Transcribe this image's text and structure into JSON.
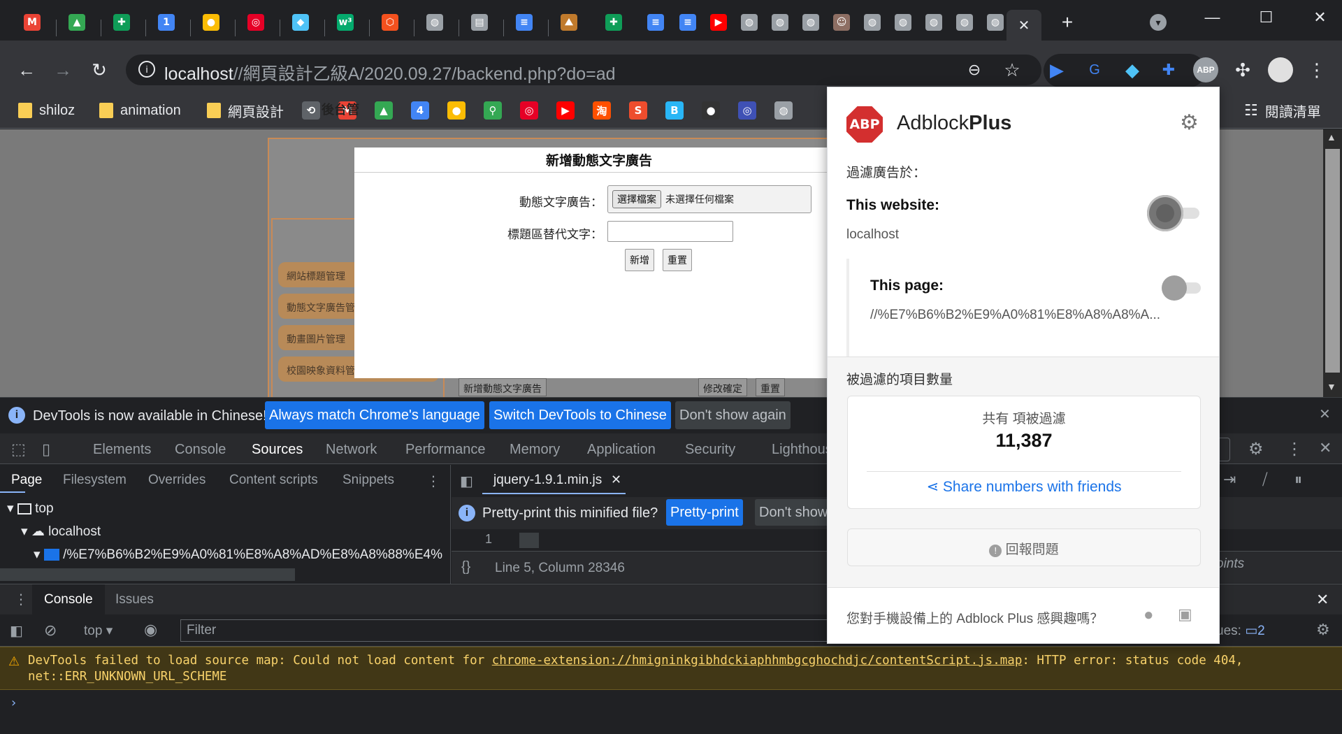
{
  "browser": {
    "url_host": "localhost",
    "url_path": "//網頁設計乙級A/2020.09.27/backend.php?do=ad",
    "tab_favicons": [
      {
        "icon": "gmail-icon",
        "glyph": "M",
        "color": "#ea4335"
      },
      {
        "icon": "google-drive-icon",
        "glyph": "▲",
        "color": "#34a853"
      },
      {
        "icon": "google-sheets-icon",
        "glyph": "✚",
        "color": "#0f9d58"
      },
      {
        "icon": "calendar-icon",
        "glyph": "1",
        "color": "#4285f4"
      },
      {
        "icon": "keep-icon",
        "glyph": "●",
        "color": "#fbbc04"
      },
      {
        "icon": "netease-music-icon",
        "glyph": "◎",
        "color": "#e60026"
      },
      {
        "icon": "diamond-icon",
        "glyph": "◆",
        "color": "#4fc3f7"
      },
      {
        "icon": "w3schools-icon",
        "glyph": "w³",
        "color": "#04aa6d"
      },
      {
        "icon": "laravel-icon",
        "glyph": "⬡",
        "color": "#f4511e"
      },
      {
        "icon": "globe-icon",
        "glyph": "◍",
        "color": "#9aa0a6"
      },
      {
        "icon": "document-icon",
        "glyph": "▤",
        "color": "#9aa0a6"
      },
      {
        "icon": "google-docs-icon",
        "glyph": "≡",
        "color": "#4285f4"
      },
      {
        "icon": "pixnet-icon",
        "glyph": "⛰",
        "color": "#c07a2c"
      },
      {
        "icon": "google-sheets-icon",
        "glyph": "✚",
        "color": "#0f9d58"
      },
      {
        "icon": "google-docs-icon",
        "glyph": "≡",
        "color": "#4285f4"
      },
      {
        "icon": "google-docs-icon",
        "glyph": "≡",
        "color": "#4285f4"
      },
      {
        "icon": "youtube-icon",
        "glyph": "▶",
        "color": "#ff0000"
      },
      {
        "icon": "globe-icon",
        "glyph": "◍",
        "color": "#9aa0a6"
      },
      {
        "icon": "globe-icon",
        "glyph": "◍",
        "color": "#9aa0a6"
      },
      {
        "icon": "globe-icon",
        "glyph": "◍",
        "color": "#9aa0a6"
      },
      {
        "icon": "profile-photo-icon",
        "glyph": "☺",
        "color": "#8d6e63"
      },
      {
        "icon": "globe-icon",
        "glyph": "◍",
        "color": "#9aa0a6"
      },
      {
        "icon": "globe-icon",
        "glyph": "◍",
        "color": "#9aa0a6"
      },
      {
        "icon": "globe-icon",
        "glyph": "◍",
        "color": "#9aa0a6"
      },
      {
        "icon": "globe-icon",
        "glyph": "◍",
        "color": "#9aa0a6"
      },
      {
        "icon": "globe-icon",
        "glyph": "◍",
        "color": "#9aa0a6"
      }
    ],
    "bookmarks": [
      {
        "label": "shiloz",
        "type": "folder"
      },
      {
        "label": "animation",
        "type": "folder"
      },
      {
        "label": "網頁設計",
        "type": "folder"
      }
    ],
    "bookmark_icons": [
      {
        "icon": "history-icon",
        "glyph": "⟲",
        "color": "#5f6368"
      },
      {
        "icon": "gmail-icon",
        "glyph": "M",
        "color": "#ea4335"
      },
      {
        "icon": "google-drive-icon",
        "glyph": "▲",
        "color": "#34a853"
      },
      {
        "icon": "calendar-icon",
        "glyph": "4",
        "color": "#4285f4"
      },
      {
        "icon": "keep-icon",
        "glyph": "●",
        "color": "#fbbc04"
      },
      {
        "icon": "maps-icon",
        "glyph": "⚲",
        "color": "#34a853"
      },
      {
        "icon": "netease-music-icon",
        "glyph": "◎",
        "color": "#e60026"
      },
      {
        "icon": "youtube-icon",
        "glyph": "▶",
        "color": "#ff0000"
      },
      {
        "icon": "taobao-icon",
        "glyph": "淘",
        "color": "#ff5000"
      },
      {
        "icon": "shopee-icon",
        "glyph": "S",
        "color": "#ee4d2d"
      },
      {
        "icon": "b-icon",
        "glyph": "B",
        "color": "#29b6f6"
      },
      {
        "icon": "github-icon",
        "glyph": "●",
        "color": "#333333"
      },
      {
        "icon": "ring-icon",
        "glyph": "◎",
        "color": "#3f51b5"
      },
      {
        "icon": "globe-icon",
        "glyph": "◍",
        "color": "#9aa0a6"
      }
    ],
    "reading_list": "閱讀清單"
  },
  "page": {
    "sidebar_title": "後台管",
    "sidebar_items": [
      "網站標題管理",
      "動態文字廣告管",
      "動畫圖片管理",
      "校園映象資料管"
    ],
    "bottom_buttons": [
      "新增動態文字廣告",
      "修改確定",
      "重置"
    ],
    "modal": {
      "title": "新增動態文字廣告",
      "label_ad": "動態文字廣告：",
      "label_alt": "標題區替代文字：",
      "file_button": "選擇檔案",
      "file_status": "未選擇任何檔案",
      "add_button": "新增",
      "reset_button": "重置"
    }
  },
  "devtools": {
    "infobar": {
      "text": "DevTools is now available in Chinese!",
      "btn_match": "Always match Chrome's language",
      "btn_switch": "Switch DevTools to Chinese",
      "btn_dismiss": "Don't show again"
    },
    "tabs": [
      "Elements",
      "Console",
      "Sources",
      "Network",
      "Performance",
      "Memory",
      "Application",
      "Security",
      "Lighthous"
    ],
    "active_tab": "Sources",
    "subtabs": [
      "Page",
      "Filesystem",
      "Overrides",
      "Content scripts",
      "Snippets"
    ],
    "tree": {
      "top": "top",
      "host": "localhost",
      "folder": "/%E7%B6%B2%E9%A0%81%E8%A8%AD%E8%A8%88%E4%"
    },
    "file_tab": "jquery-1.9.1.min.js",
    "pretty_prompt": "Pretty-print this minified file?",
    "pretty_btn": "Pretty-print",
    "pretty_dismiss": "Don't show",
    "line_number": "1",
    "position": "Line 5, Column 28346",
    "right_frag": "oints",
    "console_tabs": [
      "Console",
      "Issues"
    ],
    "context": "top",
    "filter_placeholder": "Filter",
    "issues_label": "ues:",
    "issues_count": "2",
    "warning_prefix": "DevTools failed to load source map: Could not load content for ",
    "warning_link": "chrome-extension://hmigninkgibhdckiaphhmbgcghochdjc/contentScript.js.map",
    "warning_suffix": ": HTTP error: status code 404,",
    "warning_line2": "net::ERR_UNKNOWN_URL_SCHEME"
  },
  "abp": {
    "brand_light": "Adblock",
    "brand_bold": "Plus",
    "logo_text": "ABP",
    "filter_on": "過濾廣告於：",
    "this_website": "This website:",
    "website_value": "localhost",
    "this_page": "This page:",
    "page_value": "//%E7%B6%B2%E9%A0%81%E8%A8%A8%A...",
    "blocked_heading": "被過濾的項目數量",
    "total_label": "共有 項被過濾",
    "total_count": "11,387",
    "share": "Share numbers with friends",
    "report": "回報問題",
    "mobile": "您對手機設備上的 Adblock Plus 感興趣嗎？",
    "colors": {
      "accent": "#d32f2f",
      "link": "#1a73e8"
    }
  }
}
